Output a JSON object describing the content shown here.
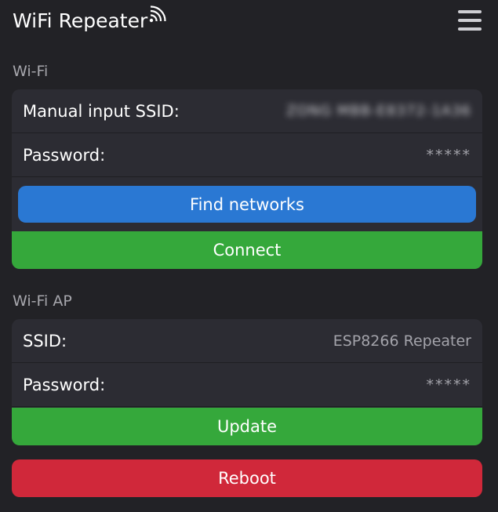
{
  "header": {
    "title": "WiFi Repeater",
    "logo_icon": "wifi-signal-icon",
    "menu_icon": "hamburger-menu-icon"
  },
  "wifi": {
    "section_title": "Wi-Fi",
    "ssid_label": "Manual input SSID:",
    "ssid_value": "ZONG MBB-E8372-1A36",
    "password_label": "Password:",
    "password_value": "*****",
    "find_networks_label": "Find networks",
    "connect_label": "Connect"
  },
  "wifi_ap": {
    "section_title": "Wi-Fi AP",
    "ssid_label": "SSID:",
    "ssid_value": "ESP8266 Repeater",
    "password_label": "Password:",
    "password_value": "*****",
    "update_label": "Update"
  },
  "reboot_label": "Reboot",
  "colors": {
    "background": "#222226",
    "card": "#2c2c33",
    "blue_button": "#2a78d3",
    "green_button": "#35a83b",
    "red_button": "#d0283a",
    "muted_text": "#a6a6ac"
  }
}
